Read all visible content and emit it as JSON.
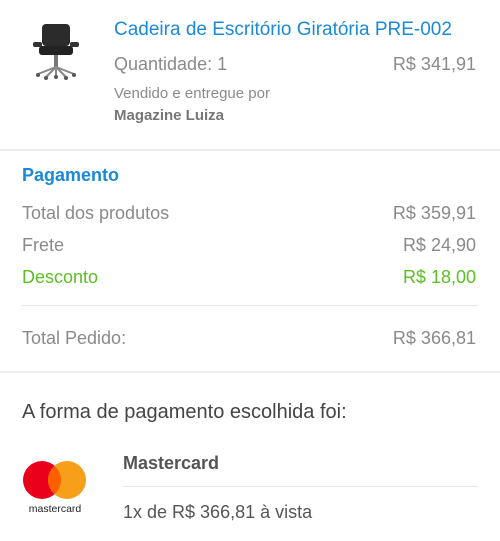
{
  "product": {
    "title": "Cadeira de Escritório Giratória PRE-002",
    "quantity": "Quantidade: 1",
    "price": "R$ 341,91",
    "sold_by": "Vendido e entregue por",
    "seller": "Magazine Luiza",
    "image_icon": "office-chair-icon"
  },
  "payment": {
    "title": "Pagamento",
    "rows": [
      {
        "label": "Total dos produtos",
        "value": "R$ 359,91"
      },
      {
        "label": "Frete",
        "value": "R$ 24,90"
      },
      {
        "label": "Desconto",
        "value": "R$ 18,00"
      }
    ],
    "total": {
      "label": "Total Pedido:",
      "value": "R$ 366,81"
    },
    "discount_color": "#5bbf21",
    "accent_color": "#1a8ad6"
  },
  "method": {
    "chosen_label": "A forma de pagamento escolhida foi:",
    "card_name": "Mastercard",
    "logo_text": "mastercard",
    "installment": "1x de R$ 366,81 à vista",
    "logo_colors": {
      "red": "#eb001b",
      "orange": "#f79e1b",
      "overlap": "#ff5f00"
    }
  }
}
